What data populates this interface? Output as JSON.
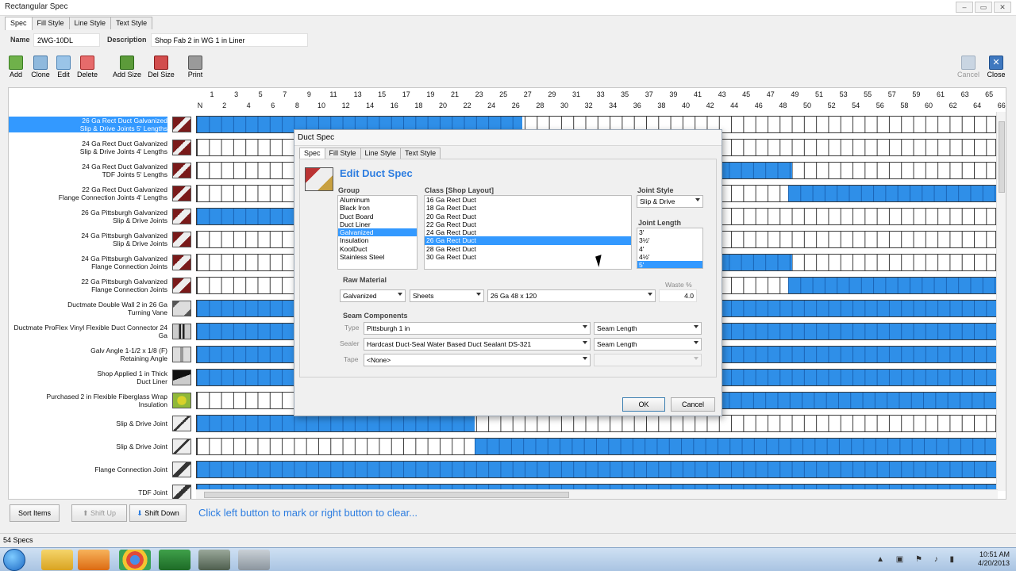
{
  "window": {
    "title": "Rectangular Spec",
    "minimize": "–",
    "restore": "▭",
    "close": "✕"
  },
  "main_tabs": [
    "Spec",
    "Fill Style",
    "Line Style",
    "Text Style"
  ],
  "fields": {
    "name_label": "Name",
    "name_value": "2WG-10DL",
    "description_label": "Description",
    "description_value": "Shop Fab 2 in WG 1 in Liner"
  },
  "toolbar": {
    "add": "Add",
    "clone": "Clone",
    "edit": "Edit",
    "delete": "Delete",
    "add_size": "Add Size",
    "del_size": "Del Size",
    "print": "Print",
    "cancel": "Cancel",
    "close": "Close"
  },
  "grid": {
    "header_odd": [
      "1",
      "3",
      "5",
      "7",
      "9",
      "11",
      "13",
      "15",
      "17",
      "19",
      "21",
      "23",
      "25",
      "27",
      "29",
      "31",
      "33",
      "35",
      "37",
      "39",
      "41",
      "43",
      "45",
      "47",
      "49",
      "51",
      "53",
      "55",
      "57",
      "59",
      "61",
      "63",
      "65"
    ],
    "header_even": [
      "N",
      "2",
      "4",
      "6",
      "8",
      "10",
      "12",
      "14",
      "16",
      "18",
      "20",
      "22",
      "24",
      "26",
      "28",
      "30",
      "32",
      "34",
      "36",
      "38",
      "40",
      "42",
      "44",
      "46",
      "48",
      "50",
      "52",
      "54",
      "56",
      "58",
      "60",
      "62",
      "64",
      "66"
    ],
    "rows": [
      {
        "line1": "26 Ga Rect Duct Galvanized",
        "line2": "Slip & Drive Joints 5' Lengths"
      },
      {
        "line1": "24 Ga Rect Duct Galvanized",
        "line2": "Slip & Drive Joints 4' Lengths"
      },
      {
        "line1": "24 Ga Rect Duct Galvanized",
        "line2": "TDF Joints 5' Lengths"
      },
      {
        "line1": "22 Ga Rect Duct Galvanized",
        "line2": "Flange Connection Joints 4' Lengths"
      },
      {
        "line1": "26 Ga Pittsburgh Galvanized",
        "line2": "Slip & Drive Joints"
      },
      {
        "line1": "24 Ga Pittsburgh Galvanized",
        "line2": "Slip & Drive Joints"
      },
      {
        "line1": "24 Ga Pittsburgh Galvanized",
        "line2": "Flange Connection Joints"
      },
      {
        "line1": "22 Ga Pittsburgh Galvanized",
        "line2": "Flange Connection Joints"
      },
      {
        "line1": "Ductmate Double Wall 2 in 26 Ga",
        "line2": "Turning Vane"
      },
      {
        "line1": "Ductmate ProFlex Vinyl Flexible Duct Connector 24",
        "line2": "Ga"
      },
      {
        "line1": "Galv Angle 1-1/2 x 1/8 (F)",
        "line2": "Retaining Angle"
      },
      {
        "line1": "Shop Applied 1 in Thick",
        "line2": "Duct Liner"
      },
      {
        "line1": "Purchased 2 in Flexible Fiberglass Wrap",
        "line2": "Insulation"
      },
      {
        "line1": "Slip & Drive Joint",
        "line2": ""
      },
      {
        "line1": "Slip & Drive Joint",
        "line2": ""
      },
      {
        "line1": "Flange Connection Joint",
        "line2": ""
      },
      {
        "line1": "TDF Joint",
        "line2": ""
      }
    ]
  },
  "bottom": {
    "sort_items": "Sort Items",
    "shift_up": "Shift Up",
    "shift_down": "Shift Down",
    "hint": "Click left button to mark or right button to clear..."
  },
  "status": {
    "count": "54 Specs"
  },
  "taskbar": {
    "time": "10:51 AM",
    "date": "4/20/2013"
  },
  "dialog": {
    "title": "Duct Spec",
    "tabs": [
      "Spec",
      "Fill Style",
      "Line Style",
      "Text Style"
    ],
    "heading": "Edit Duct Spec",
    "group_label": "Group",
    "groups": [
      "Aluminum",
      "Black Iron",
      "Duct Board",
      "Duct Liner",
      "Galvanized",
      "Insulation",
      "KoolDuct",
      "Stainless Steel"
    ],
    "group_selected": 4,
    "class_label": "Class [Shop Layout]",
    "classes": [
      "16 Ga Rect Duct",
      "18 Ga Rect Duct",
      "20 Ga Rect Duct",
      "22 Ga Rect Duct",
      "24 Ga Rect Duct",
      "26 Ga Rect Duct",
      "28 Ga Rect Duct",
      "30 Ga Rect Duct"
    ],
    "class_selected": 5,
    "joint_style_label": "Joint Style",
    "joint_style_value": "Slip & Drive",
    "joint_length_label": "Joint Length",
    "joint_lengths": [
      "3'",
      "3½'",
      "4'",
      "4½'",
      "5'"
    ],
    "joint_length_selected": 4,
    "raw_material_label": "Raw Material",
    "raw_material": {
      "material": "Galvanized",
      "form": "Sheets",
      "size": "26 Ga 48 x 120"
    },
    "waste_label": "Waste %",
    "waste_value": "4.0",
    "seam_label": "Seam Components",
    "seam_type_label": "Type",
    "seam_type_value": "Pittsburgh 1 in",
    "seam_type_measure": "Seam Length",
    "sealer_label": "Sealer",
    "sealer_value": "Hardcast Duct-Seal Water Based Duct Sealant DS-321",
    "sealer_measure": "Seam Length",
    "tape_label": "Tape",
    "tape_value": "<None>",
    "ok": "OK",
    "cancel": "Cancel"
  }
}
